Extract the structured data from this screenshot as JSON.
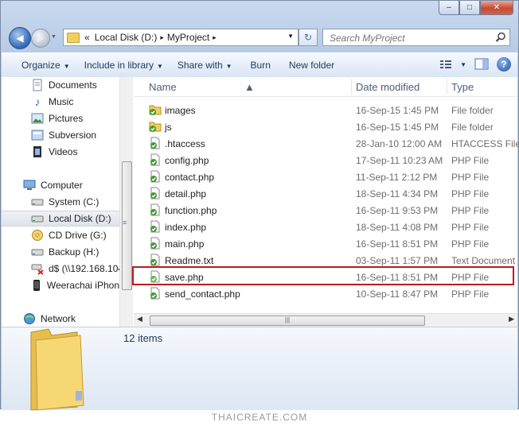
{
  "window": {
    "controls": {
      "minimize": "–",
      "maximize": "□",
      "close": "✕"
    }
  },
  "navigation": {
    "back_icon": "arrow-left-icon",
    "forward_icon": "arrow-right-icon",
    "address": {
      "overflow": "«",
      "segments": [
        "Local Disk (D:)",
        "MyProject"
      ],
      "separator": "▸"
    },
    "search_placeholder": "Search MyProject"
  },
  "commandbar": {
    "items": [
      {
        "label": "Organize",
        "dropdown": true
      },
      {
        "label": "Include in library",
        "dropdown": true
      },
      {
        "label": "Share with",
        "dropdown": true
      },
      {
        "label": "Burn",
        "dropdown": false
      },
      {
        "label": "New folder",
        "dropdown": false
      }
    ],
    "help": "?"
  },
  "sidebar": {
    "items": [
      {
        "label": "Documents",
        "icon": "documents-icon",
        "indent": 1
      },
      {
        "label": "Music",
        "icon": "music-icon",
        "indent": 1
      },
      {
        "label": "Pictures",
        "icon": "pictures-icon",
        "indent": 1
      },
      {
        "label": "Subversion",
        "icon": "subversion-icon",
        "indent": 1
      },
      {
        "label": "Videos",
        "icon": "videos-icon",
        "indent": 1
      },
      {
        "label": "Computer",
        "icon": "computer-icon",
        "indent": 0
      },
      {
        "label": "System (C:)",
        "icon": "drive-icon",
        "indent": 1
      },
      {
        "label": "Local Disk (D:)",
        "icon": "drive-icon",
        "indent": 1,
        "selected": true
      },
      {
        "label": "CD Drive (G:)",
        "icon": "cd-drive-icon",
        "indent": 1
      },
      {
        "label": "Backup (H:)",
        "icon": "drive-icon",
        "indent": 1
      },
      {
        "label": "d$ (\\\\192.168.104",
        "icon": "network-drive-icon",
        "indent": 1
      },
      {
        "label": "Weerachai iPhon",
        "icon": "phone-icon",
        "indent": 1
      },
      {
        "label": "Network",
        "icon": "network-icon",
        "indent": 0
      }
    ]
  },
  "filelist": {
    "columns": {
      "name": "Name",
      "date": "Date modified",
      "type": "Type"
    },
    "rows": [
      {
        "name": "images",
        "date": "16-Sep-15 1:45 PM",
        "type": "File folder",
        "icon": "folder-svn-icon"
      },
      {
        "name": "js",
        "date": "16-Sep-15 1:45 PM",
        "type": "File folder",
        "icon": "folder-svn-icon"
      },
      {
        "name": ".htaccess",
        "date": "28-Jan-10 12:00 AM",
        "type": "HTACCESS File",
        "icon": "file-svn-icon"
      },
      {
        "name": "config.php",
        "date": "17-Sep-11 10:23 AM",
        "type": "PHP File",
        "icon": "file-svn-icon"
      },
      {
        "name": "contact.php",
        "date": "11-Sep-11 2:12 PM",
        "type": "PHP File",
        "icon": "file-svn-icon"
      },
      {
        "name": "detail.php",
        "date": "18-Sep-11 4:34 PM",
        "type": "PHP File",
        "icon": "file-svn-icon"
      },
      {
        "name": "function.php",
        "date": "16-Sep-11 9:53 PM",
        "type": "PHP File",
        "icon": "file-svn-icon"
      },
      {
        "name": "index.php",
        "date": "18-Sep-11 4:08 PM",
        "type": "PHP File",
        "icon": "file-svn-icon"
      },
      {
        "name": "main.php",
        "date": "16-Sep-11 8:51 PM",
        "type": "PHP File",
        "icon": "file-svn-icon"
      },
      {
        "name": "Readme.txt",
        "date": "03-Sep-11 1:57 PM",
        "type": "Text Document",
        "icon": "file-svn-icon"
      },
      {
        "name": "save.php",
        "date": "16-Sep-11 8:51 PM",
        "type": "PHP File",
        "icon": "file-svn-added-icon",
        "highlighted": true
      },
      {
        "name": "send_contact.php",
        "date": "10-Sep-11 8:47 PM",
        "type": "PHP File",
        "icon": "file-svn-icon"
      }
    ]
  },
  "details": {
    "count": "12 items",
    "icon": "folder-large-icon"
  },
  "footer": {
    "watermark": "THAICREATE.COM"
  },
  "colors": {
    "svn_green": "#3d9a2f",
    "highlight_border": "#c0181e",
    "folder_yellow": "#f1cf5b"
  }
}
